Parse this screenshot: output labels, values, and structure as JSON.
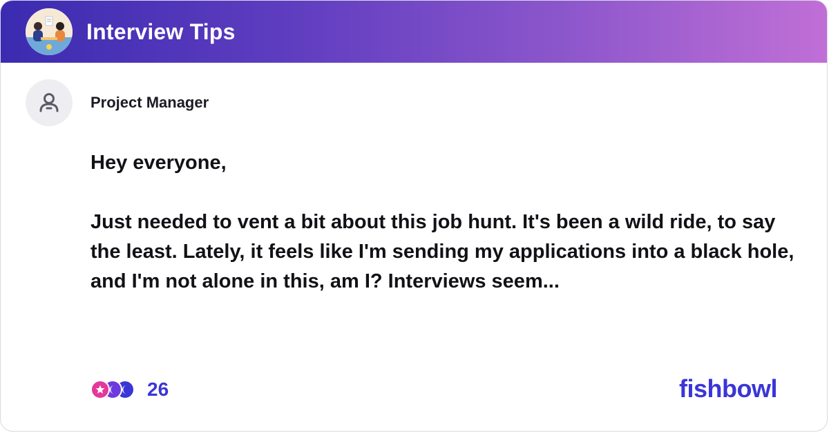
{
  "header": {
    "title": "Interview Tips",
    "avatar_icon": "interview-illustration-icon",
    "gradient_start": "#3b2bb0",
    "gradient_end": "#c06fd6"
  },
  "author": {
    "title": "Project Manager",
    "avatar_icon": "person-icon"
  },
  "post": {
    "greeting": "Hey everyone,",
    "body": "Just needed to vent a bit about this job hunt. It's been a wild ride, to say the least. Lately, it feels like I'm sending my applications into a black hole, and I'm not alone in this, am I? Interviews seem..."
  },
  "reactions": {
    "count": "26",
    "icons": [
      "star-reaction-icon",
      "moon-reaction-icon",
      "moon-reaction-icon"
    ],
    "colors": [
      "#e4389a",
      "#6d3ae0",
      "#3a35d6"
    ]
  },
  "brand": {
    "name": "fishbowl",
    "color": "#3a35d6"
  }
}
